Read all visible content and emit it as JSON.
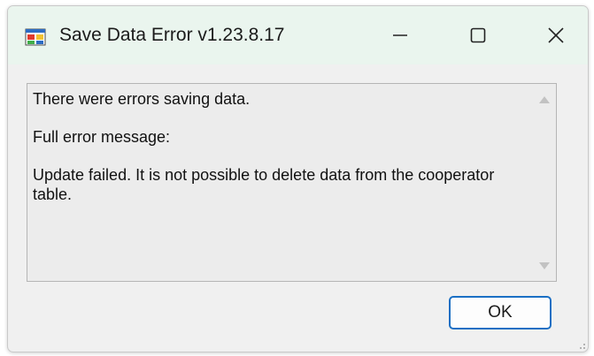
{
  "window": {
    "title": "Save Data Error v1.23.8.17",
    "icon": "app-window-icon",
    "controls": [
      "minimize-icon",
      "maximize-icon",
      "close-icon"
    ]
  },
  "message": {
    "line1": "There were errors saving data.",
    "line2": "Full error message:",
    "line3": "Update failed.  It is not possible to delete data from the cooperator table."
  },
  "buttons": {
    "ok_label": "OK"
  },
  "colors": {
    "titlebar": "#eaf5ee",
    "dialog_bg": "#f0f0f0",
    "textbox_bg": "#ececec",
    "button_border": "#1a6fc4"
  }
}
